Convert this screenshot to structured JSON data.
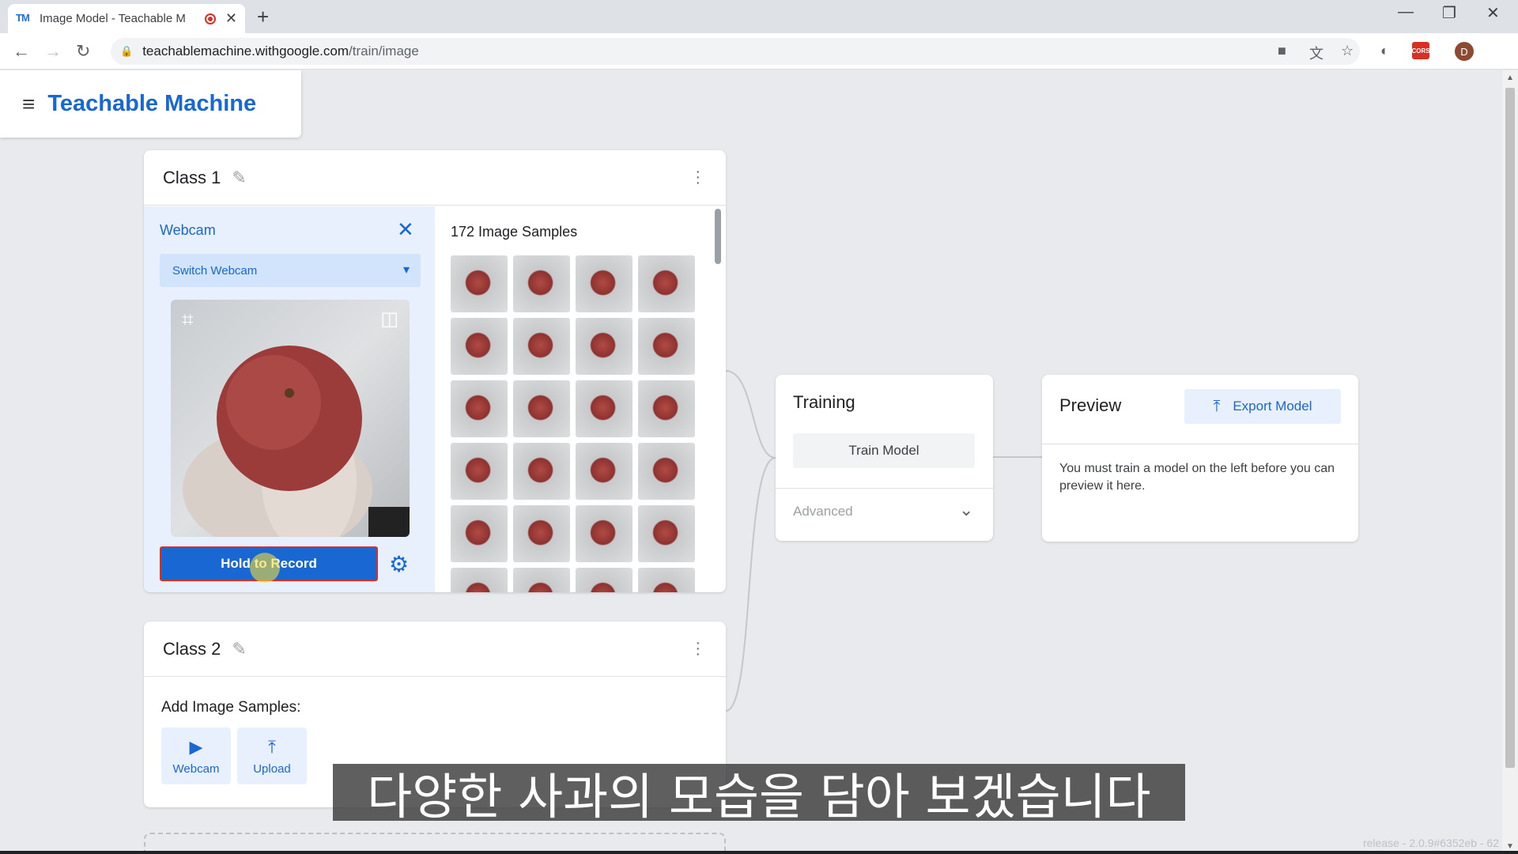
{
  "browser": {
    "tab_favicon": "TM",
    "tab_title": "Image Model - Teachable M",
    "url_host": "teachablemachine.withgoogle.com",
    "url_path": "/train/image",
    "profile_initial": "D",
    "ext_label": "CORS"
  },
  "app": {
    "name": "Teachable Machine"
  },
  "class1": {
    "name": "Class 1",
    "webcam_title": "Webcam",
    "switch_label": "Switch Webcam",
    "hold_label": "Hold to Record",
    "samples_title": "172 Image Samples"
  },
  "class2": {
    "name": "Class 2",
    "add_label": "Add Image Samples:",
    "webcam_label": "Webcam",
    "upload_label": "Upload"
  },
  "training": {
    "title": "Training",
    "train_label": "Train Model",
    "advanced_label": "Advanced"
  },
  "preview": {
    "title": "Preview",
    "export_label": "Export Model",
    "message": "You must train a model on the left before you can preview it here."
  },
  "subtitle": "다양한 사과의 모습을 담아 보겠습니다",
  "release": "release - 2.0.9#6352eb - 62",
  "colors": {
    "accent": "#1967d2",
    "record_border": "#d93025"
  }
}
